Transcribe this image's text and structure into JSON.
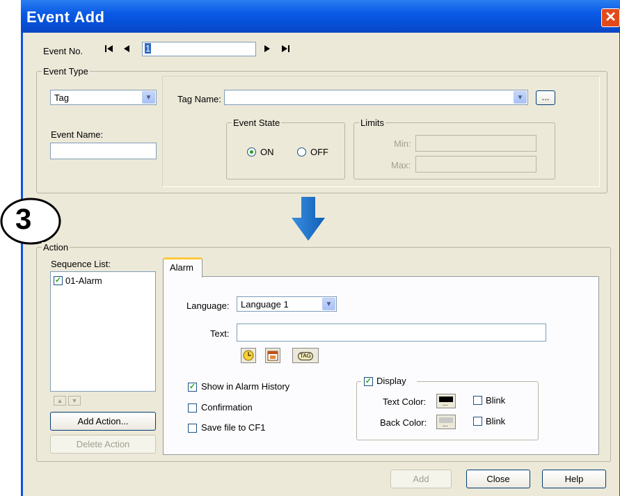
{
  "window": {
    "title": "Event Add",
    "close_symbol": "✕"
  },
  "event_no": {
    "label": "Event No.",
    "first_symbol": "⏮",
    "prev_symbol": "◀",
    "value": "1",
    "next_symbol": "▶",
    "last_symbol": "⏭"
  },
  "event_type": {
    "group_label": "Event Type",
    "type_value": "Tag",
    "event_name_label": "Event Name:",
    "event_name_value": "",
    "tag_name_label": "Tag Name:",
    "tag_name_value": "",
    "browse_label": "...",
    "event_state": {
      "group_label": "Event State",
      "on_label": "ON",
      "off_label": "OFF",
      "selected": "ON"
    },
    "limits": {
      "group_label": "Limits",
      "min_label": "Min:",
      "max_label": "Max:"
    }
  },
  "annotation": {
    "step_number": "3"
  },
  "action": {
    "group_label": "Action",
    "sequence_list_label": "Sequence List:",
    "sequence_items": [
      {
        "label": "01-Alarm",
        "checked": true
      }
    ],
    "add_action_label": "Add Action...",
    "delete_action_label": "Delete Action",
    "tab_label": "Alarm",
    "language_label": "Language:",
    "language_value": "Language 1",
    "text_label": "Text:",
    "text_value": "",
    "insert_icons": [
      "clock-icon",
      "calendar-icon",
      "tag-icon"
    ],
    "tag_icon_text": "TAG",
    "show_in_alarm_history_label": "Show in Alarm History",
    "show_in_alarm_history_checked": true,
    "confirmation_label": "Confirmation",
    "confirmation_checked": false,
    "save_file_label": "Save file to CF1",
    "save_file_checked": false,
    "display_label": "Display",
    "display_checked": true,
    "text_color_label": "Text Color:",
    "text_color": "#000000",
    "back_color_label": "Back Color:",
    "back_color": "#c8c8c8",
    "blink_label": "Blink",
    "color_btn_symbol": "..."
  },
  "footer": {
    "add_label": "Add",
    "close_label": "Close",
    "help_label": "Help"
  },
  "colors": {
    "titlebar": "#0a5ae6",
    "dialog_bg": "#ece9d8",
    "arrow": "#1a73c9"
  }
}
